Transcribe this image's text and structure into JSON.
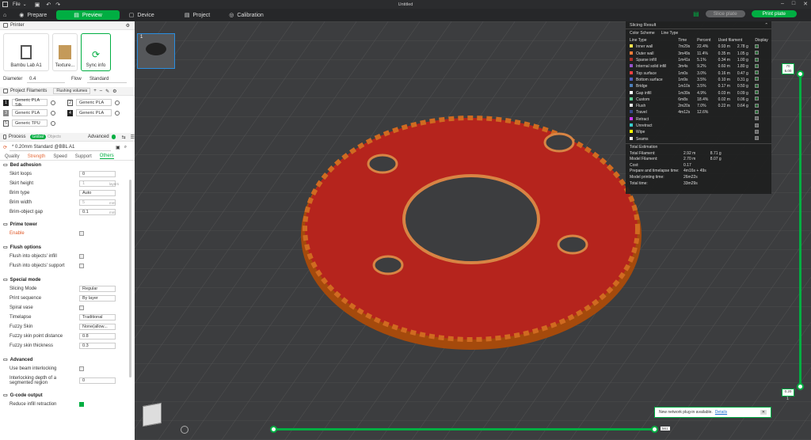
{
  "window": {
    "title": "Untitled",
    "file_menu": "File"
  },
  "nav": {
    "tabs": [
      {
        "label": "Prepare"
      },
      {
        "label": "Preview"
      },
      {
        "label": "Device"
      },
      {
        "label": "Project"
      },
      {
        "label": "Calibration"
      }
    ],
    "active": "Preview",
    "slice_label": "Slice plate",
    "print_label": "Print plate"
  },
  "printer": {
    "section": "Printer",
    "printer_name": "Bambu Lab A1",
    "plate": "Texture...",
    "sync": "Sync info",
    "diameter_label": "Diameter",
    "diameter": "0.4",
    "flow_label": "Flow",
    "flow": "Standard"
  },
  "filaments": {
    "section": "Project Filaments",
    "flushing": "Flushing volumes",
    "items": [
      {
        "num": "1",
        "name": "Generic PLA Silk"
      },
      {
        "num": "2",
        "name": "Generic PLA"
      },
      {
        "num": "3",
        "name": "Generic PLA"
      },
      {
        "num": "4",
        "name": "Generic PLA"
      },
      {
        "num": "5",
        "name": "Generic TPU"
      }
    ]
  },
  "process": {
    "section": "Process",
    "global": "Global",
    "objects": "Objects",
    "advanced": "Advanced",
    "preset": "* 0.20mm Standard @BBL A1",
    "tabs": [
      "Quality",
      "Strength",
      "Speed",
      "Support",
      "Others"
    ],
    "active_tab": "Others",
    "bed_adhesion": "Bed adhesion",
    "skirt_loops_l": "Skirt loops",
    "skirt_loops": "0",
    "skirt_height_l": "Skirt height",
    "skirt_height": "1",
    "skirt_height_u": "layers",
    "brim_type_l": "Brim type",
    "brim_type": "Auto",
    "brim_width_l": "Brim width",
    "brim_width": "5",
    "brim_width_u": "mm",
    "brim_gap_l": "Brim-object gap",
    "brim_gap": "0.1",
    "brim_gap_u": "mm",
    "prime_tower": "Prime tower",
    "enable": "Enable",
    "flush_options": "Flush options",
    "flush_infill": "Flush into objects' infill",
    "flush_support": "Flush into objects' support",
    "special_mode": "Special mode",
    "slicing_mode_l": "Slicing Mode",
    "slicing_mode": "Regular",
    "print_seq_l": "Print sequence",
    "print_seq": "By layer",
    "spiral_l": "Spiral vase",
    "timelapse_l": "Timelapse",
    "timelapse": "Traditional",
    "fuzzy_l": "Fuzzy Skin",
    "fuzzy": "None(allow...",
    "fuzzy_dist_l": "Fuzzy skin point distance",
    "fuzzy_dist": "0.8",
    "fuzzy_thick_l": "Fuzzy skin thickness",
    "fuzzy_thick": "0.3",
    "advanced_grp": "Advanced",
    "beam_l": "Use beam interlocking",
    "interlock_l": "Interlocking depth of a segmented region",
    "interlock": "0",
    "gcode": "G-code output",
    "reduce_l": "Reduce infill retraction"
  },
  "slicing": {
    "title": "Slicing Result",
    "color_scheme_l": "Color Scheme",
    "color_scheme": "Line Type",
    "headers": [
      "Line Type",
      "Time",
      "Percent",
      "Used filament",
      "Display"
    ],
    "rows": [
      {
        "type": "Inner wall",
        "time": "7m29s",
        "pct": "22.4%",
        "m": "0.93 m",
        "g": "2.78 g",
        "color": "#ffe54f"
      },
      {
        "type": "Outer wall",
        "time": "3m49s",
        "pct": "11.4%",
        "m": "0.35 m",
        "g": "1.05 g",
        "color": "#ff7d38"
      },
      {
        "type": "Sparse infill",
        "time": "1m41s",
        "pct": "5.1%",
        "m": "0.34 m",
        "g": "1.00 g",
        "color": "#b03029"
      },
      {
        "type": "Internal solid infill",
        "time": "3m4s",
        "pct": "9.2%",
        "m": "0.60 m",
        "g": "1.80 g",
        "color": "#9654cc"
      },
      {
        "type": "Top surface",
        "time": "1m0s",
        "pct": "3.0%",
        "m": "0.16 m",
        "g": "0.47 g",
        "color": "#f04040"
      },
      {
        "type": "Bottom surface",
        "time": "1m9s",
        "pct": "3.5%",
        "m": "0.10 m",
        "g": "0.31 g",
        "color": "#5060c0"
      },
      {
        "type": "Bridge",
        "time": "1m10s",
        "pct": "3.5%",
        "m": "0.17 m",
        "g": "0.50 g",
        "color": "#4d80ba"
      },
      {
        "type": "Gap infill",
        "time": "1m39s",
        "pct": "4.9%",
        "m": "0.03 m",
        "g": "0.09 g",
        "color": "#ffffff"
      },
      {
        "type": "Custom",
        "time": "6m8s",
        "pct": "18.4%",
        "m": "0.02 m",
        "g": "0.06 g",
        "color": "#5ed194"
      },
      {
        "type": "Flush",
        "time": "2m20s",
        "pct": "7.0%",
        "m": "0.22 m",
        "g": "0.64 g",
        "color": "#e6e6e6"
      },
      {
        "type": "Travel",
        "time": "4m12s",
        "pct": "12.6%",
        "m": "",
        "g": "",
        "color": "#38488c"
      },
      {
        "type": "Retract",
        "time": "",
        "pct": "",
        "m": "",
        "g": "",
        "color": "#cc38ff"
      },
      {
        "type": "Unretract",
        "time": "",
        "pct": "",
        "m": "",
        "g": "",
        "color": "#38cccc"
      },
      {
        "type": "Wipe",
        "time": "",
        "pct": "",
        "m": "",
        "g": "",
        "color": "#ffff00"
      },
      {
        "type": "Seams",
        "time": "",
        "pct": "",
        "m": "",
        "g": "",
        "color": "#e6e6e6"
      }
    ],
    "total_title": "Total Estimation",
    "totals": [
      {
        "k": "Total Filament:",
        "v1": "2.92 m",
        "v2": "8.71 g"
      },
      {
        "k": "Model Filament:",
        "v1": "2.70 m",
        "v2": "8.07 g"
      },
      {
        "k": "Cost:",
        "v1": "0.17",
        "v2": ""
      },
      {
        "k": "Prepare and timelapse time:",
        "v1": "4m16s + 49s",
        "v2": ""
      },
      {
        "k": "Model printing time:",
        "v1": "26m22s",
        "v2": ""
      },
      {
        "k": "Total time:",
        "v1": "33m29s",
        "v2": ""
      }
    ]
  },
  "slider": {
    "top_layer": "70",
    "top_height": "6.00",
    "bottom_height": "0.20",
    "bottom_layer": "1",
    "move": "561"
  },
  "plate_num": "1",
  "toast": {
    "text": "New network plug-in available.",
    "link": "Details"
  }
}
